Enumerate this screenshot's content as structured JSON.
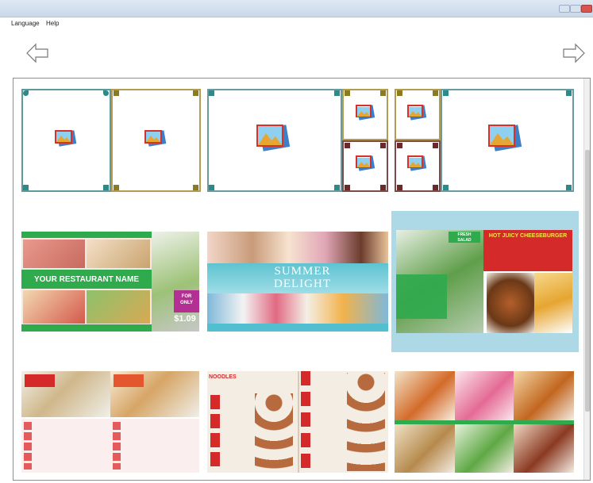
{
  "menu": {
    "language": "Language",
    "help": "Help"
  },
  "nav": {
    "back_icon": "arrow-left-icon",
    "forward_icon": "arrow-right-icon"
  },
  "colors": {
    "frame": "#6a9aa0",
    "photo_border": "#d5322b",
    "photo_back": "#3f7fc6",
    "selected_bg": "#add8e6",
    "green": "#2faa4d",
    "red": "#d52a2a"
  },
  "templates": {
    "restaurant": {
      "name": "YOUR RESTAURANT NAME",
      "only": "ONLY",
      "for": "FOR",
      "price": "$1.09"
    },
    "summer": {
      "line1": "SUMMER",
      "line2": "DELIGHT"
    },
    "cheeseburger": {
      "title": "HOT JUICY CHEESEBURGER",
      "badge1": "FRESH",
      "badge2": "SALAD"
    },
    "noodles": {
      "title": "NOODLES"
    }
  }
}
